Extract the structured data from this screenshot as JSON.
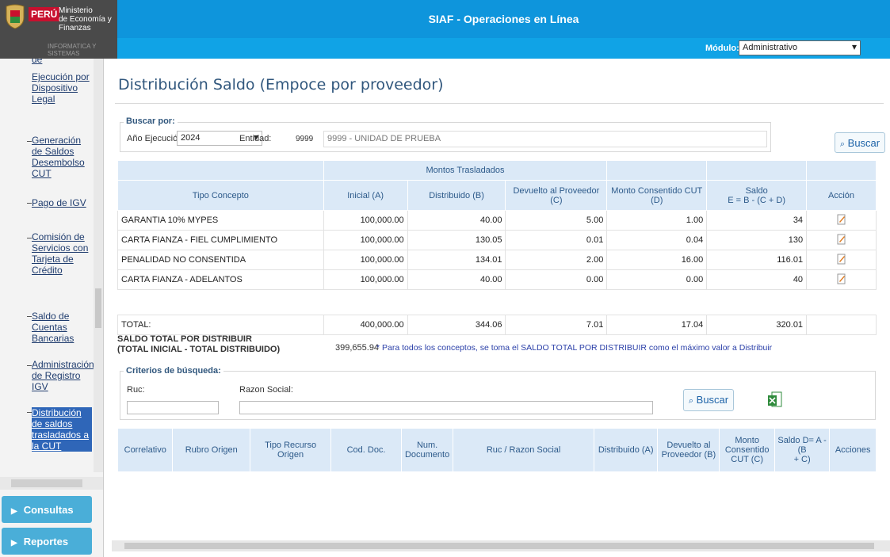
{
  "header": {
    "org_brand": "PERÚ",
    "org_line1": "Ministerio",
    "org_line2": "de Economía y Finanzas",
    "org_sub": "INFORMATICA Y SISTEMAS",
    "app_title": "SIAF - Operaciones en Línea",
    "module_label": "Módulo:",
    "module_value": "Administrativo"
  },
  "sidebar": {
    "items": [
      {
        "label": "de"
      },
      {
        "label": "Ejecución por Dispositivo Legal"
      },
      {
        "label": "Generación de Saldos Desembolso CUT"
      },
      {
        "label": "Pago de IGV"
      },
      {
        "label": "Comisión de Servicios con Tarjeta de Crédito"
      },
      {
        "label": "Saldo de Cuentas Bancarias"
      },
      {
        "label": "Administración de Registro IGV"
      },
      {
        "label": "Distribución de saldos trasladados a la CUT"
      }
    ],
    "accordion": [
      {
        "label": "Consultas"
      },
      {
        "label": "Reportes"
      }
    ]
  },
  "page": {
    "title": "Distribución Saldo (Empoce por proveedor)"
  },
  "search": {
    "legend": "Buscar por:",
    "year_label": "Año Ejecución:",
    "year_value": "2024",
    "entity_label": "Entidad:",
    "entity_code": "9999",
    "entity_name": "9999 - UNIDAD DE PRUEBA",
    "button_label": "Buscar"
  },
  "table": {
    "group_header": "Montos Trasladados",
    "columns": {
      "tipo": "Tipo Concepto",
      "inicial": "Inicial (A)",
      "distribuido": "Distribuido (B)",
      "devuelto": "Devuelto al Proveedor (C)",
      "consentido": "Monto Consentido CUT (D)",
      "saldo_line1": "Saldo",
      "saldo_line2": "E = B - (C + D)",
      "accion": "Acción"
    },
    "rows": [
      {
        "tipo": "GARANTIA 10% MYPES",
        "inicial": "100,000.00",
        "distribuido": "40.00",
        "devuelto": "5.00",
        "consentido": "1.00",
        "saldo": "34"
      },
      {
        "tipo": "CARTA FIANZA - FIEL CUMPLIMIENTO",
        "inicial": "100,000.00",
        "distribuido": "130.05",
        "devuelto": "0.01",
        "consentido": "0.04",
        "saldo": "130"
      },
      {
        "tipo": "PENALIDAD NO CONSENTIDA",
        "inicial": "100,000.00",
        "distribuido": "134.01",
        "devuelto": "2.00",
        "consentido": "16.00",
        "saldo": "116.01"
      },
      {
        "tipo": "CARTA FIANZA - ADELANTOS",
        "inicial": "100,000.00",
        "distribuido": "40.00",
        "devuelto": "0.00",
        "consentido": "0.00",
        "saldo": "40"
      }
    ],
    "totals": {
      "label": "TOTAL:",
      "inicial": "400,000.00",
      "distribuido": "344.06",
      "devuelto": "7.01",
      "consentido": "17.04",
      "saldo": "320.01"
    }
  },
  "summary": {
    "label_line1": "SALDO TOTAL POR DISTRIBUIR",
    "label_line2": "(TOTAL INICIAL - TOTAL DISTRIBUIDO)",
    "value": "399,655.94",
    "note": "* Para todos los conceptos, se toma el SALDO TOTAL POR DISTRIBUIR como el máximo valor a Distribuir"
  },
  "criteria": {
    "legend": "Criterios de búsqueda:",
    "ruc_label": "Ruc:",
    "razon_label": "Razon Social:",
    "button_label": "Buscar"
  },
  "detail_table": {
    "columns": {
      "correlativo": "Correlativo",
      "rubro": "Rubro Origen",
      "tipo_recurso_1": "Tipo Recurso",
      "tipo_recurso_2": "Origen",
      "cod_doc": "Cod. Doc.",
      "num_doc_1": "Num.",
      "num_doc_2": "Documento",
      "ruc_razon": "Ruc / Razon Social",
      "distribuido": "Distribuido (A)",
      "devuelto_1": "Devuelto al",
      "devuelto_2": "Proveedor (B)",
      "monto_1": "Monto",
      "monto_2": "Consentido",
      "monto_3": "CUT (C)",
      "saldo_1": "Saldo D= A - (B",
      "saldo_2": "+ C)",
      "acciones": "Acciones"
    }
  },
  "colors": {
    "header_blue": "#0e95dc",
    "title_blue": "#31577d",
    "table_header_bg": "#dbe9f7",
    "sidebar_active": "#2f66b8",
    "accordion_blue": "#4aaed8"
  }
}
